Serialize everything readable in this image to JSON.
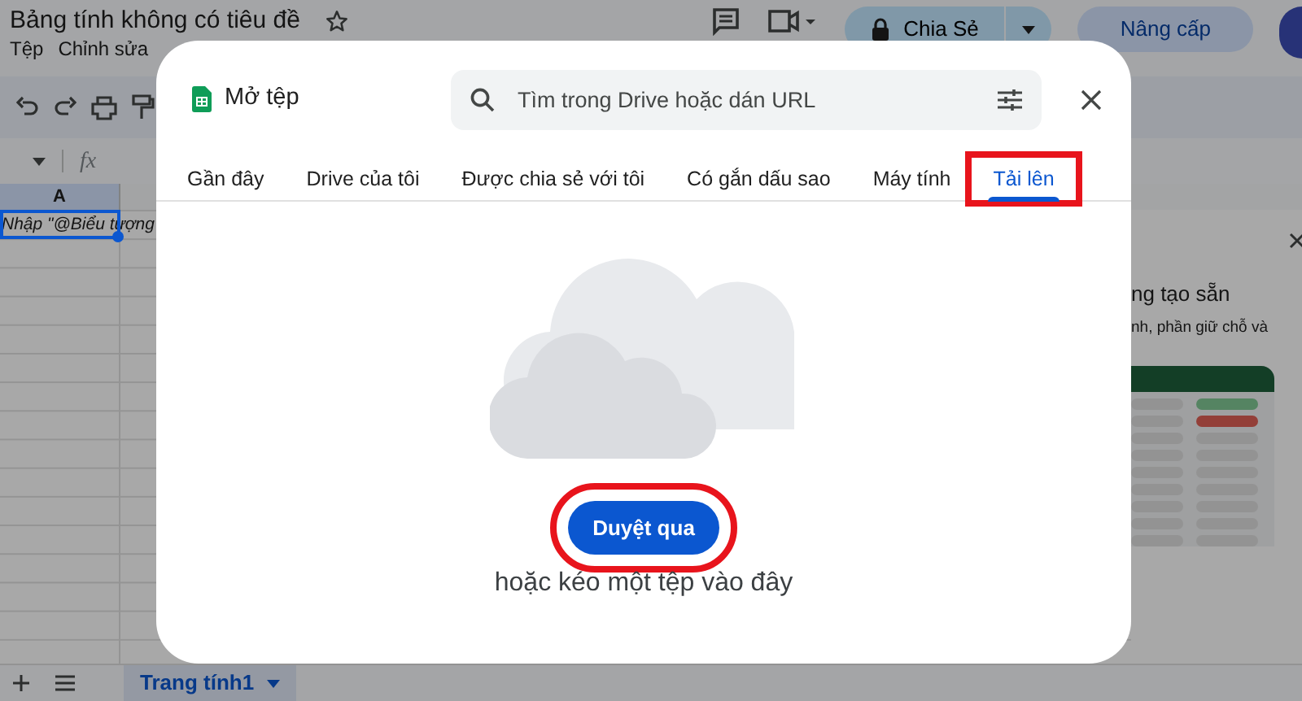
{
  "document": {
    "title": "Bảng tính không có tiêu đề",
    "starred": false
  },
  "menu": [
    "Tệp",
    "Chỉnh sửa"
  ],
  "share_button": {
    "label": "Chia Sẻ"
  },
  "upgrade_button": {
    "label": "Nâng cấp"
  },
  "formula_bar": {
    "fx": "fx"
  },
  "column_headers": [
    "A"
  ],
  "cell_a1": {
    "value": "Nhập \"@Biểu tượng"
  },
  "side_panel": {
    "title": "ng tạo sẵn",
    "description": "nh, phần giữ chỗ và"
  },
  "sheet_tabs": [
    {
      "label": "Trang tính1",
      "selected": true
    }
  ],
  "dialog": {
    "title": "Mở tệp",
    "search": {
      "placeholder": "Tìm trong Drive hoặc dán URL"
    },
    "tabs": [
      {
        "label": "Gần đây",
        "selected": false,
        "highlighted": false
      },
      {
        "label": "Drive của tôi",
        "selected": false,
        "highlighted": false
      },
      {
        "label": "Được chia sẻ với tôi",
        "selected": false,
        "highlighted": false
      },
      {
        "label": "Có gắn dấu sao",
        "selected": false,
        "highlighted": false
      },
      {
        "label": "Máy tính",
        "selected": false,
        "highlighted": false
      },
      {
        "label": "Tải lên",
        "selected": true,
        "highlighted": true
      }
    ],
    "browse_button": {
      "label": "Duyệt qua",
      "highlighted": true
    },
    "drop_hint": "hoặc kéo một tệp vào đây"
  }
}
